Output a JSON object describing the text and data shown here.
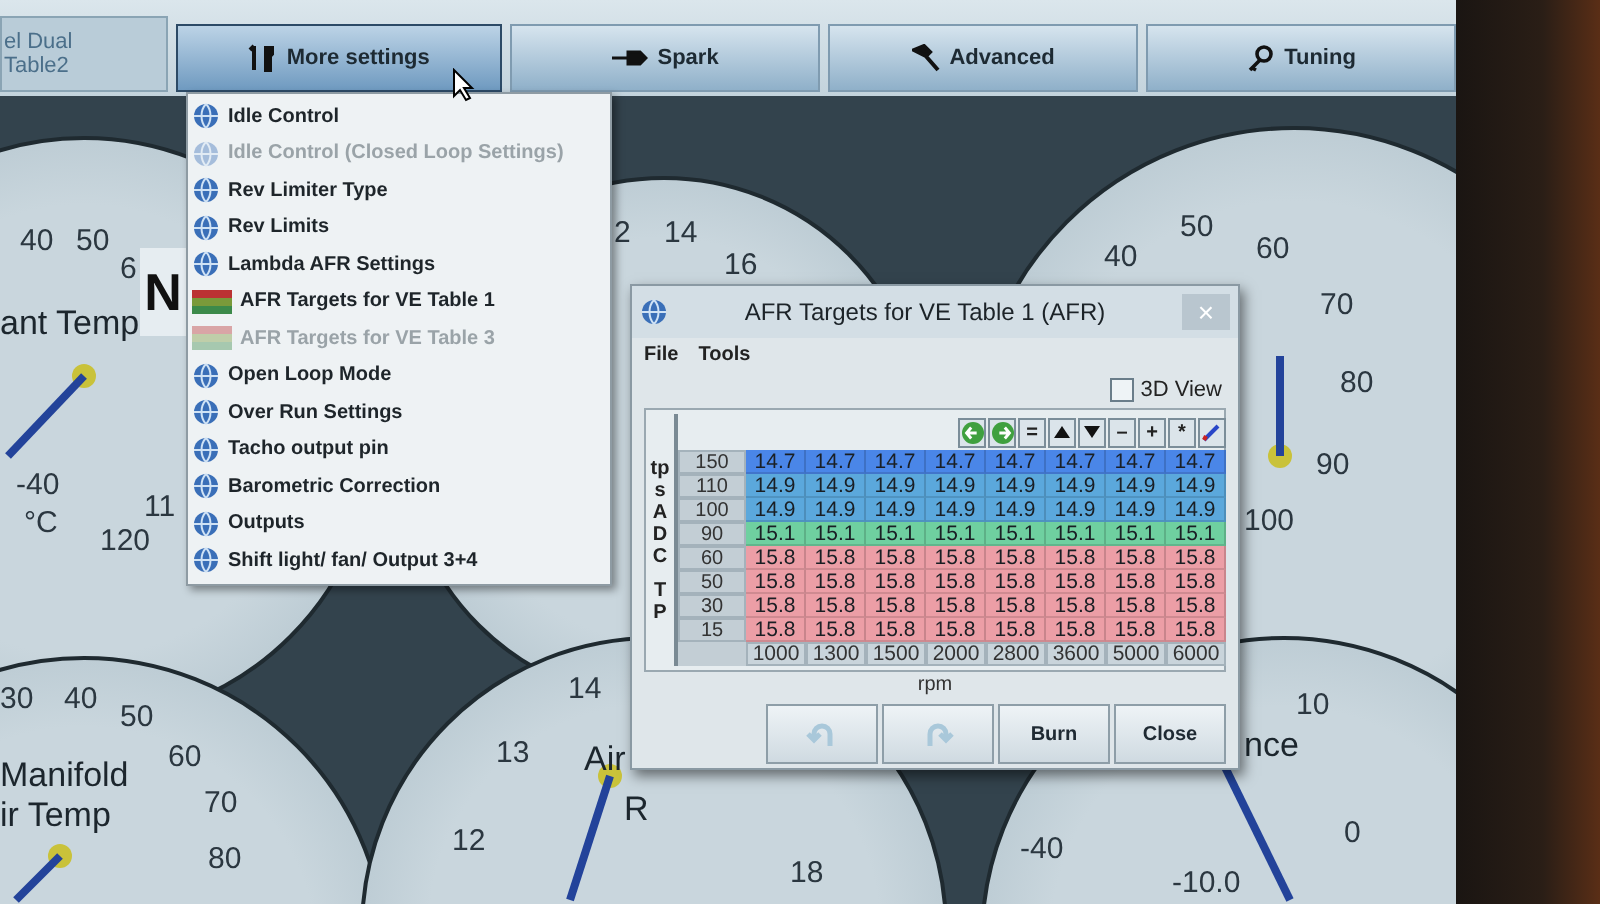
{
  "top_bar": {
    "file_label": [
      "el Dual",
      "Table2"
    ],
    "tabs": [
      {
        "label": "More settings",
        "selected": true
      },
      {
        "label": "Spark",
        "selected": false
      },
      {
        "label": "Advanced",
        "selected": false
      },
      {
        "label": "Tuning",
        "selected": false
      }
    ]
  },
  "dashboard": {
    "n_box": "N",
    "gauges": [
      {
        "texts": [
          {
            "kind": "tick",
            "text": "40"
          },
          {
            "kind": "tick",
            "text": "50"
          },
          {
            "kind": "tick",
            "text": "6"
          },
          {
            "kind": "label",
            "text": "ant Temp"
          },
          {
            "kind": "tick",
            "text": "-40"
          },
          {
            "kind": "tick",
            "text": "°C"
          },
          {
            "kind": "tick",
            "text": "11"
          },
          {
            "kind": "tick",
            "text": "120"
          }
        ]
      },
      {
        "texts": [
          {
            "kind": "tick",
            "text": "2"
          },
          {
            "kind": "tick",
            "text": "14"
          },
          {
            "kind": "tick",
            "text": "16"
          }
        ]
      },
      {
        "texts": [
          {
            "kind": "tick",
            "text": "40"
          },
          {
            "kind": "tick",
            "text": "50"
          },
          {
            "kind": "tick",
            "text": "60"
          },
          {
            "kind": "tick",
            "text": "70"
          },
          {
            "kind": "tick",
            "text": "80"
          },
          {
            "kind": "tick",
            "text": "90"
          },
          {
            "kind": "tick",
            "text": "100"
          }
        ]
      },
      {
        "texts": [
          {
            "kind": "tick",
            "text": "30"
          },
          {
            "kind": "tick",
            "text": "40"
          },
          {
            "kind": "tick",
            "text": "50"
          },
          {
            "kind": "tick",
            "text": "60"
          },
          {
            "kind": "tick",
            "text": "70"
          },
          {
            "kind": "tick",
            "text": "80"
          },
          {
            "kind": "label",
            "text": "Manifold"
          },
          {
            "kind": "label",
            "text": "ir Temp"
          }
        ]
      },
      {
        "texts": [
          {
            "kind": "tick",
            "text": "14"
          },
          {
            "kind": "tick",
            "text": "13"
          },
          {
            "kind": "tick",
            "text": "12"
          },
          {
            "kind": "label",
            "text": "Air"
          },
          {
            "kind": "label",
            "text": "R"
          },
          {
            "kind": "tick",
            "text": "18"
          }
        ]
      },
      {
        "texts": [
          {
            "kind": "tick",
            "text": "10"
          },
          {
            "kind": "tick",
            "text": "0"
          },
          {
            "kind": "tick",
            "text": "-10.0"
          },
          {
            "kind": "tick",
            "text": "-40"
          },
          {
            "kind": "label",
            "text": "nce"
          }
        ]
      }
    ]
  },
  "menu": {
    "items": [
      {
        "label": "Idle Control",
        "kind": "setting",
        "disabled": false
      },
      {
        "label": "Idle Control (Closed Loop Settings)",
        "kind": "setting",
        "disabled": true
      },
      {
        "label": "Rev Limiter Type",
        "kind": "setting",
        "disabled": false
      },
      {
        "label": "Rev Limits",
        "kind": "setting",
        "disabled": false
      },
      {
        "label": "Lambda AFR Settings",
        "kind": "setting",
        "disabled": false
      },
      {
        "label": "AFR Targets for VE Table 1",
        "kind": "table",
        "disabled": false
      },
      {
        "label": "AFR Targets for VE Table 3",
        "kind": "table",
        "disabled": true
      },
      {
        "label": "Open Loop Mode",
        "kind": "setting",
        "disabled": false
      },
      {
        "label": "Over Run Settings",
        "kind": "setting",
        "disabled": false
      },
      {
        "label": "Tacho output pin",
        "kind": "setting",
        "disabled": false
      },
      {
        "label": "Barometric Correction",
        "kind": "setting",
        "disabled": false
      },
      {
        "label": "Outputs",
        "kind": "setting",
        "disabled": false
      },
      {
        "label": "Shift light/ fan/ Output 3+4",
        "kind": "setting",
        "disabled": false
      }
    ]
  },
  "dialog": {
    "title": "AFR Targets for VE Table 1 (AFR)",
    "close": "×",
    "menu": [
      "File",
      "Tools"
    ],
    "view_3d": {
      "label": "3D View",
      "checked": false
    },
    "toolbar": [
      {
        "kind": "left"
      },
      {
        "kind": "right"
      },
      {
        "kind": "text",
        "text": "="
      },
      {
        "kind": "up"
      },
      {
        "kind": "down"
      },
      {
        "kind": "text",
        "text": "–"
      },
      {
        "kind": "text",
        "text": "+"
      },
      {
        "kind": "text",
        "text": "*"
      },
      {
        "kind": "pen"
      }
    ],
    "y_axis": [
      "tpsADC",
      "TP"
    ],
    "rows": [
      {
        "label": "150",
        "color": "#4a86e8",
        "values": [
          "14.7",
          "14.7",
          "14.7",
          "14.7",
          "14.7",
          "14.7",
          "14.7",
          "14.7"
        ]
      },
      {
        "label": "110",
        "color": "#5ba8dc",
        "values": [
          "14.9",
          "14.9",
          "14.9",
          "14.9",
          "14.9",
          "14.9",
          "14.9",
          "14.9"
        ]
      },
      {
        "label": "100",
        "color": "#5ba8dc",
        "values": [
          "14.9",
          "14.9",
          "14.9",
          "14.9",
          "14.9",
          "14.9",
          "14.9",
          "14.9"
        ]
      },
      {
        "label": "90",
        "color": "#6fd0a0",
        "values": [
          "15.1",
          "15.1",
          "15.1",
          "15.1",
          "15.1",
          "15.1",
          "15.1",
          "15.1"
        ]
      },
      {
        "label": "60",
        "color": "#ec9ea6",
        "values": [
          "15.8",
          "15.8",
          "15.8",
          "15.8",
          "15.8",
          "15.8",
          "15.8",
          "15.8"
        ]
      },
      {
        "label": "50",
        "color": "#ec9ea6",
        "values": [
          "15.8",
          "15.8",
          "15.8",
          "15.8",
          "15.8",
          "15.8",
          "15.8",
          "15.8"
        ]
      },
      {
        "label": "30",
        "color": "#ec9ea6",
        "values": [
          "15.8",
          "15.8",
          "15.8",
          "15.8",
          "15.8",
          "15.8",
          "15.8",
          "15.8"
        ]
      },
      {
        "label": "15",
        "color": "#ec9ea6",
        "values": [
          "15.8",
          "15.8",
          "15.8",
          "15.8",
          "15.8",
          "15.8",
          "15.8",
          "15.8"
        ]
      }
    ],
    "x_axis": [
      "1000",
      "1300",
      "1500",
      "2000",
      "2800",
      "3600",
      "5000",
      "6000"
    ],
    "x_label": "rpm",
    "buttons": [
      {
        "kind": "undo",
        "disabled": true
      },
      {
        "kind": "redo",
        "disabled": true
      },
      {
        "kind": "text",
        "label": "Burn",
        "disabled": false
      },
      {
        "kind": "text",
        "label": "Close",
        "disabled": false
      }
    ]
  }
}
